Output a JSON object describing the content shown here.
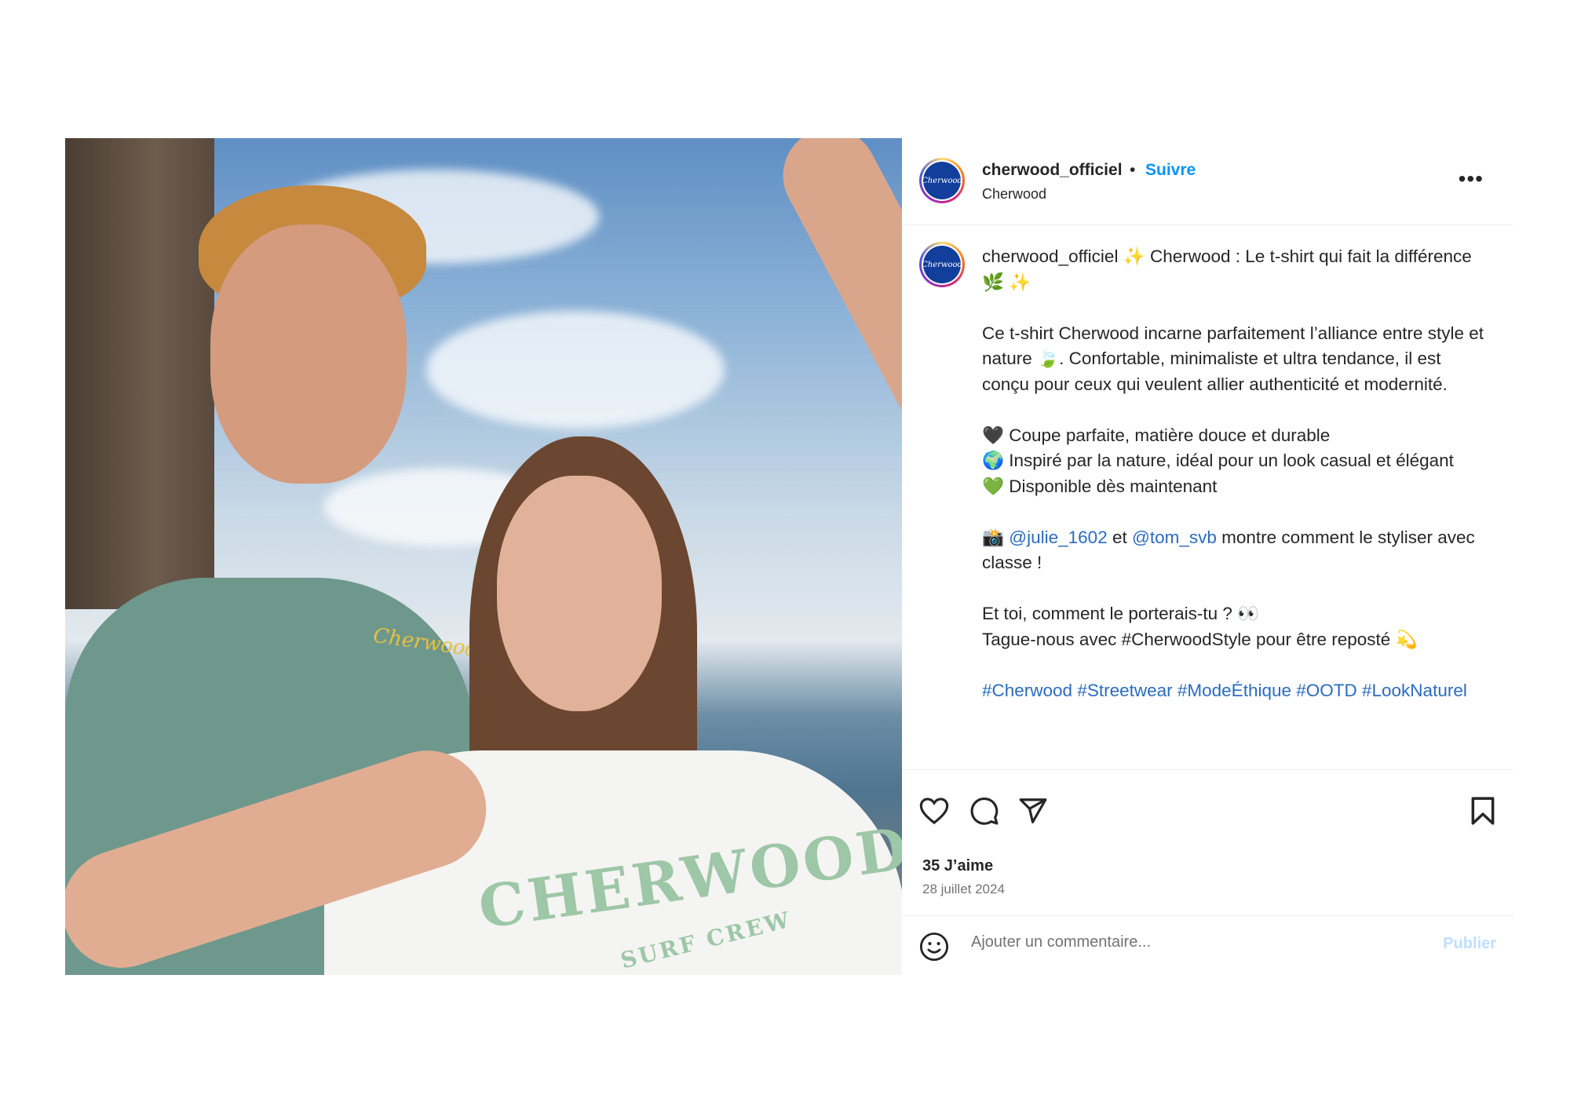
{
  "post": {
    "photo_alt": "",
    "tee_logo": "CHERWOOD",
    "tee_sub": "SURF CREW",
    "man_logo": "Cherwood"
  },
  "header": {
    "username": "cherwood_officiel",
    "separator": "•",
    "follow_label": "Suivre",
    "subtitle": "Cherwood",
    "avatar_text": "Cherwood",
    "more_label": "•••"
  },
  "caption": {
    "username": "cherwood_officiel",
    "line1": "✨ Cherwood : Le t-shirt qui fait la différence 🌿 ✨",
    "para2": "Ce t-shirt Cherwood incarne parfaitement l’alliance entre style et nature 🍃. Confortable, minimaliste et ultra tendance, il est conçu pour ceux qui veulent allier authenticité et modernité.",
    "bullet1": "🖤 Coupe parfaite, matière douce et durable",
    "bullet2": "🌍 Inspiré par la nature, idéal pour un look casual et élégant",
    "bullet3": "💚 Disponible dès maintenant",
    "credit_prefix": "📸",
    "mention1": "@julie_1602",
    "credit_and": "et",
    "mention2": "@tom_svb",
    "credit_suffix": "montre comment le styliser avec classe !",
    "question": "Et toi, comment le porterais-tu ? 👀",
    "tag_line": "Tague-nous avec #CherwoodStyle pour être reposté 💫",
    "hashtags": "#Cherwood #Streetwear #ModeÉthique #OOTD #LookNaturel"
  },
  "actions": {
    "like_icon": "heart-icon",
    "comment_icon": "comment-icon",
    "share_icon": "share-icon",
    "save_icon": "bookmark-icon"
  },
  "stats": {
    "likes": "35 J’aime",
    "date": "28 juillet 2024"
  },
  "comment": {
    "placeholder": "Ajouter un commentaire...",
    "publish_label": "Publier",
    "emoji_icon": "smiley-icon"
  }
}
